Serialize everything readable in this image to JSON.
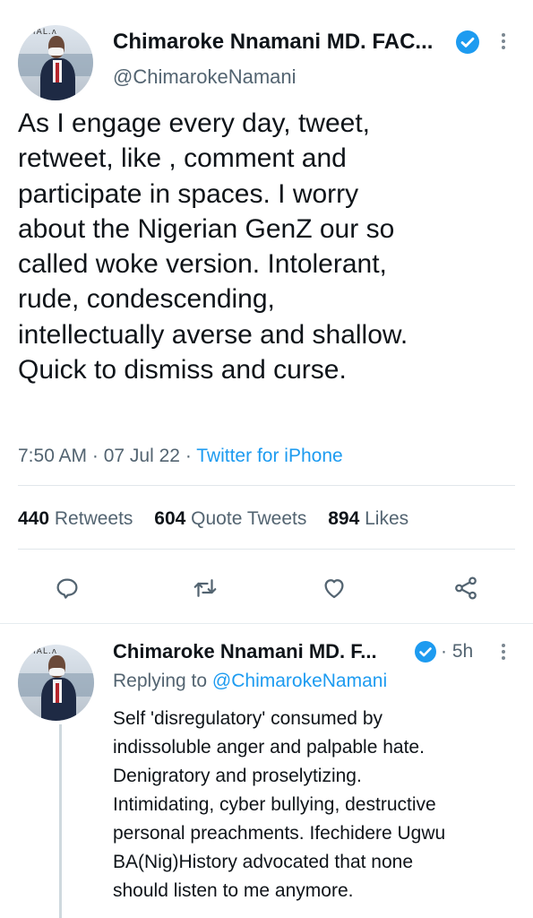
{
  "main_tweet": {
    "author_name": "Chimaroke Nnamani MD. FAC...",
    "handle": "@ChimarokeNamani",
    "text_lines": [
      "As I engage every day, tweet,",
      "retweet, like , comment and",
      "participate in spaces. I worry",
      "about the Nigerian GenZ our so",
      "called woke version. Intolerant,",
      "rude, condescending,",
      "intellectually averse and shallow.",
      "Quick to dismiss and curse."
    ],
    "time": "7:50 AM",
    "date": "07 Jul 22",
    "source": "Twitter for iPhone",
    "stats": {
      "retweets_count": "440",
      "retweets_label": "Retweets",
      "quotes_count": "604",
      "quotes_label": "Quote Tweets",
      "likes_count": "894",
      "likes_label": "Likes"
    }
  },
  "reply_tweet": {
    "author_name": "Chimaroke Nnamani MD. F...",
    "time": "5h",
    "replying_label": "Replying to",
    "replying_to": "@ChimarokeNamani",
    "text_lines": [
      "Self 'disregulatory' consumed by",
      "indissoluble anger and palpable hate.",
      "Denigratory and proselytizing.",
      "Intimidating, cyber bullying, destructive",
      "personal preachments. Ifechidere Ugwu",
      "BA(Nig)History advocated that none",
      "should listen to me anymore."
    ]
  },
  "icons": {
    "reply": "reply-icon",
    "retweet": "retweet-icon",
    "like": "heart-icon",
    "share": "share-icon",
    "verified": "verified-badge-icon",
    "more": "more-vertical-icon"
  },
  "colors": {
    "accent": "#1d9bf0",
    "text_primary": "#0f1419",
    "text_secondary": "#536471"
  }
}
